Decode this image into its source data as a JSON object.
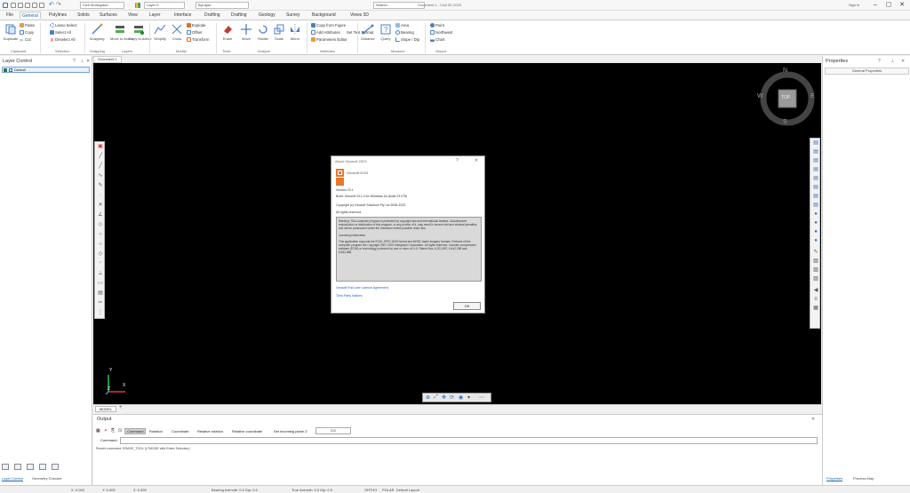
{
  "titlebar": {
    "app_combo": "Civil Workspace",
    "layer_combo": "Layer 0",
    "color_combo": "ByLayer",
    "search_text": "Search",
    "doc_title": "Document 1 - Civil 3D 2023",
    "user": "Sign in"
  },
  "menu": [
    "File",
    "General",
    "Polylines",
    "Solids",
    "Surfaces",
    "View",
    "Layer",
    "Interface",
    "Drafting",
    "Drafting",
    "Geology",
    "Survey",
    "Background",
    "Views 3D"
  ],
  "ribbon": {
    "clipboard": {
      "label": "Clipboard",
      "big": "Duplicate",
      "items": [
        "Paste",
        "Copy",
        "Cut"
      ]
    },
    "selection": {
      "label": "Selection",
      "items": [
        "Lasso Select",
        "Select All",
        "Deselect All"
      ]
    },
    "snapping": {
      "label": "Snapping",
      "big": "Snapping"
    },
    "layers": {
      "label": "Layers",
      "items": [
        "Move to Active",
        "Copy to Active"
      ]
    },
    "modify": {
      "label": "Modify",
      "items": [
        "Simplify",
        "Cross",
        "Explode",
        "Offset",
        "Transform"
      ]
    },
    "tools": {
      "label": "Tools",
      "big": "Erase"
    },
    "analyze": {
      "label": "Analyze",
      "items": [
        "Move",
        "Rotate",
        "Scale",
        "Mirror"
      ]
    },
    "attributes": {
      "label": "Attributes",
      "items": [
        "Copy from Figure",
        "Add Attributes",
        "Parameters Editor",
        "Set Text Format"
      ]
    },
    "measure": {
      "label": "Measure",
      "items": [
        "Distance",
        "Query",
        "Area",
        "Bearing",
        "Slope / Dip"
      ]
    },
    "output": {
      "label": "Output",
      "items": [
        "Point",
        "Northwest",
        "Chart"
      ]
    }
  },
  "layer_panel": {
    "title": "Layer Control",
    "row": "Default"
  },
  "properties_panel": {
    "title": "Properties",
    "tab": "General Properties"
  },
  "doc_tab": "Document 1",
  "compass": {
    "n": "N",
    "s": "S",
    "e": "E",
    "w": "W",
    "top": "TOP"
  },
  "axes": {
    "x": "X",
    "y": "Y",
    "z": "Z"
  },
  "dialog": {
    "title": "About Geosoft 2023",
    "brand": "Geosoft 2023",
    "version": "Version 23.1",
    "build": "Build: Geosoft 23.1.0 for Windows 64 (build 23.078)",
    "copyright": "Copyright (c) Geosoft Solutions Pty Ltd 2006-2023",
    "rights": "All rights reserved.",
    "warning": "Warning: This computer program is protected by copyright law and international treaties. Unauthorized reproduction or distribution of this program, or any portion of it, may result in severe civil and criminal penalties, and will be prosecuted under the maximum extent possible under law.",
    "licensing_title": "Licensing information",
    "licensing": "This application supports the ECW, JPEG 2000 format and MrSID raster imagery formats. Portions of this computer program are Copyright 2007-2023 Intergraph Corporation. All rights reserved. Includes compression software (ECW) or technology protected by one or more of U.S. Patent Nos. 6,201,897, 6,442,298 and 6,633,688.",
    "link1": "Geosoft End User Licence Agreement",
    "link2": "Third Party Notices",
    "ok": "OK"
  },
  "model_tab": "MODEL",
  "output": {
    "title": "Output",
    "tabs": [
      "Command",
      "Rotation",
      "Coordinate",
      "Relative rotation",
      "Relative coordinate",
      "Set incoming plane Z"
    ],
    "plane_value": "0.0",
    "command_label": "Command:",
    "log": "Recent command: ERASE_TOOL (LTMODE with Entire Selection)"
  },
  "left_bottom_tabs": [
    "Layer Control",
    "Geometry Checker"
  ],
  "right_bottom_tabs": [
    "Properties",
    "Process Map"
  ],
  "status": {
    "x": "X: 0.000",
    "y": "Y: 0.000",
    "z": "Z: 0.000",
    "bearing1": "Bearing Azimuth: 0.0 Dip: 0.0",
    "bearing2": "True Azimuth: 0.0 Dip: 0.0",
    "ortho": "ORTHO",
    "polar": "POLAR",
    "layout": "Default Layout"
  }
}
